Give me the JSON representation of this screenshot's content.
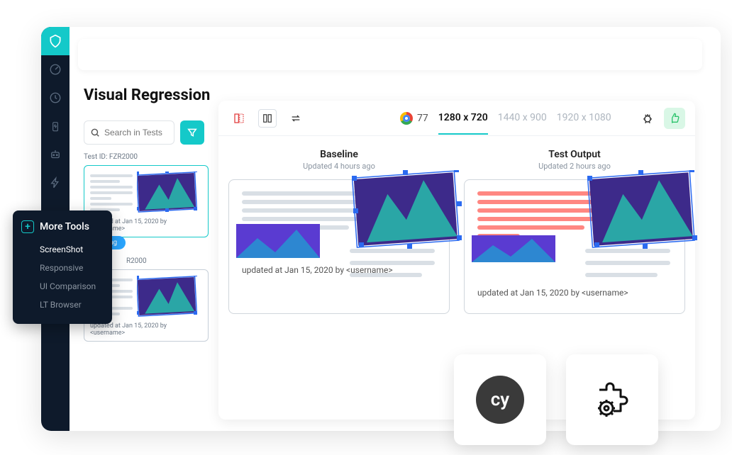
{
  "page": {
    "title": "Visual Regression"
  },
  "search": {
    "placeholder": "Search in Tests"
  },
  "toolbar": {
    "browser_version": "77",
    "resolutions": [
      "1280 x 720",
      "1440 x 900",
      "1920 x 1080"
    ]
  },
  "tests": [
    {
      "id_label": "Test ID: FZR2000",
      "updated": "updated at Jan 15, 2020 by <username>",
      "badge": "Screening"
    },
    {
      "id_label": "R2000",
      "updated": "updated at Jan 15, 2020 by <username>"
    }
  ],
  "compare": {
    "baseline": {
      "title": "Baseline",
      "subtitle": "Updated 4 hours ago",
      "updated": "updated at Jan 15, 2020 by <username>"
    },
    "output": {
      "title": "Test Output",
      "subtitle": "Updated 2 hours ago",
      "updated": "updated at Jan 15, 2020 by <username>"
    }
  },
  "more_tools": {
    "header": "More Tools",
    "items": [
      "ScreenShot",
      "Responsive",
      "UI Comparison",
      "LT Browser"
    ]
  },
  "float": {
    "cypress": "cy"
  }
}
